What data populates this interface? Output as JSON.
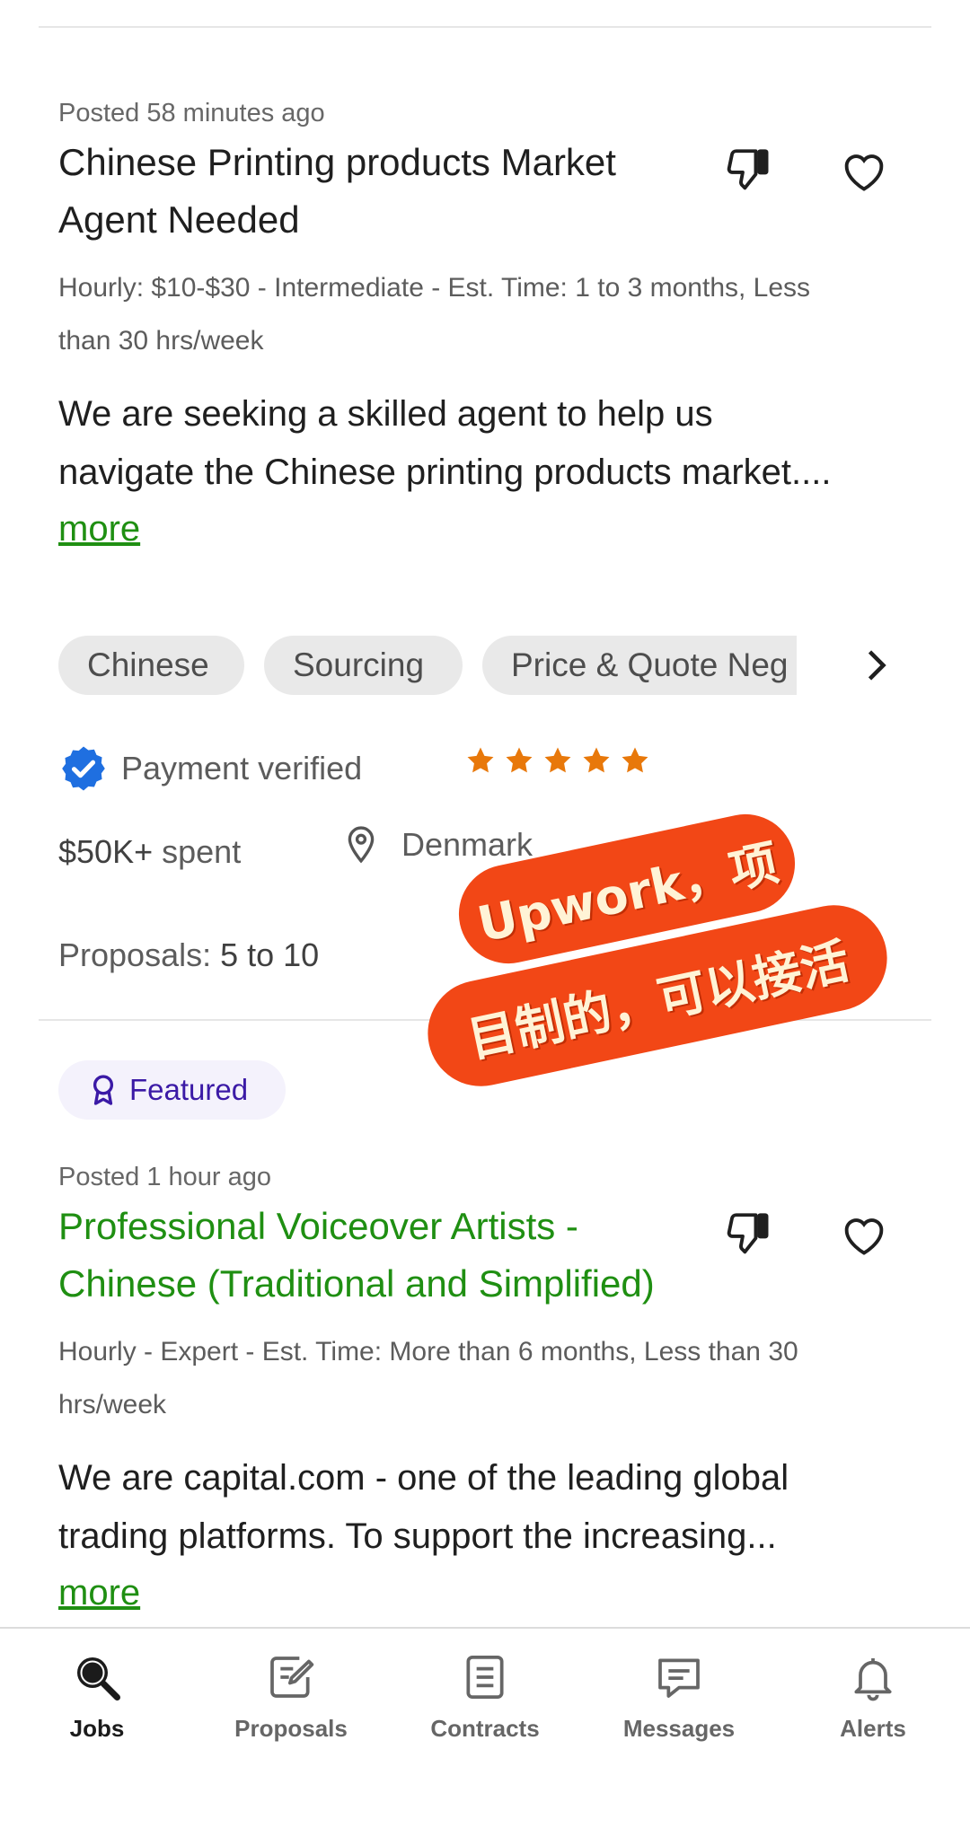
{
  "jobs": [
    {
      "posted": "Posted 58 minutes ago",
      "title_line1": "Chinese Printing products Market",
      "title_line2": "Agent Needed",
      "meta_line1": "Hourly: $10-$30 - Intermediate - Est. Time: 1 to 3 months, Less",
      "meta_line2": "than 30 hrs/week",
      "desc_line1": "We are seeking a skilled agent to help us",
      "desc_line2": "navigate the Chinese printing products market....",
      "more": "more",
      "skills": [
        "Chinese",
        "Sourcing",
        "Price & Quote Neg"
      ],
      "payment": "Payment verified",
      "rating": 5,
      "spent_amount": "$50K+",
      "spent_label": "spent",
      "location": "Denmark",
      "proposals_label": "Proposals:",
      "proposals_value": "5 to 10"
    },
    {
      "badge": "Featured",
      "posted": "Posted 1 hour ago",
      "title_line1": "Professional Voiceover Artists -",
      "title_line2": "Chinese (Traditional and Simplified)",
      "meta_line1": "Hourly - Expert - Est. Time: More than 6 months, Less than 30",
      "meta_line2": "hrs/week",
      "desc_line1": "We are capital.com - one of the leading global",
      "desc_line2": "trading platforms. To support the increasing...",
      "more": "more"
    }
  ],
  "stamp": {
    "line1": "Upwork，项",
    "line2": "目制的，可以接活"
  },
  "tabs": [
    {
      "label": "Jobs",
      "icon": "search-icon",
      "active": true
    },
    {
      "label": "Proposals",
      "icon": "proposal-edit-icon"
    },
    {
      "label": "Contracts",
      "icon": "document-icon"
    },
    {
      "label": "Messages",
      "icon": "message-icon"
    },
    {
      "label": "Alerts",
      "icon": "bell-icon"
    }
  ],
  "colors": {
    "accent_green": "#1f8f12",
    "star_orange": "#e8780a",
    "verified_blue": "#1f6fe0",
    "featured_purple": "#3b1aa6",
    "stamp_red": "#f24716"
  }
}
